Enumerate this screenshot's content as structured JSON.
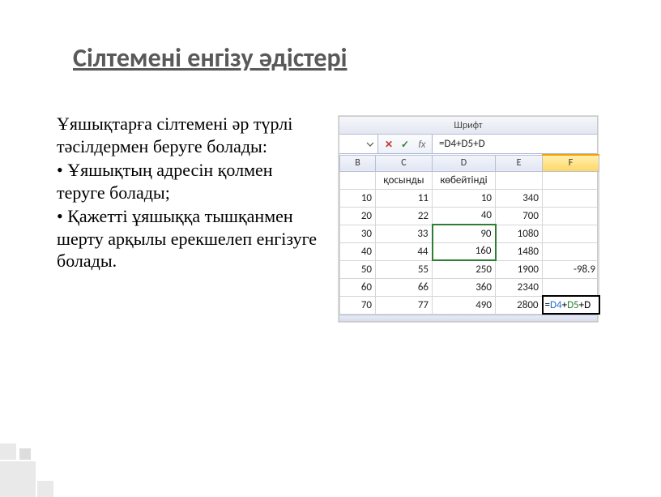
{
  "title": "Сілтемені енгізу әдістері",
  "body": {
    "intro": "Ұяшықтарға сілтемені әр түрлі тәсілдермен беруге болады:",
    "bullet1": "• Ұяшықтың адресін қолмен теруге болады;",
    "bullet2": "• Қажетті ұяшыққа тышқанмен шерту арқылы ерекшелеп енгізуге болады."
  },
  "excel": {
    "ribbon_group": "Шрифт",
    "fx_cancel": "✕",
    "fx_enter": "✓",
    "fx_label": "fx",
    "formula_bar": "=D4+D5+D",
    "columns": [
      "B",
      "C",
      "D",
      "E",
      "F"
    ],
    "header_row": {
      "c": "қосынды",
      "d": "көбейтінді"
    },
    "rows": [
      {
        "b": "10",
        "c": "11",
        "d": "10",
        "e": "340",
        "f": ""
      },
      {
        "b": "20",
        "c": "22",
        "d": "40",
        "e": "700",
        "f": ""
      },
      {
        "b": "30",
        "c": "33",
        "d": "90",
        "e": "1080",
        "f": ""
      },
      {
        "b": "40",
        "c": "44",
        "d": "160",
        "e": "1480",
        "f": ""
      },
      {
        "b": "50",
        "c": "55",
        "d": "250",
        "e": "1900",
        "f": "-98.9"
      },
      {
        "b": "60",
        "c": "66",
        "d": "360",
        "e": "2340",
        "f": ""
      },
      {
        "b": "70",
        "c": "77",
        "d": "490",
        "e": "2800",
        "f_edit": {
          "eq": "=",
          "d4": "D4",
          "op1": "+",
          "d5": "D5",
          "op2": "+",
          "tail": "D"
        }
      }
    ]
  }
}
